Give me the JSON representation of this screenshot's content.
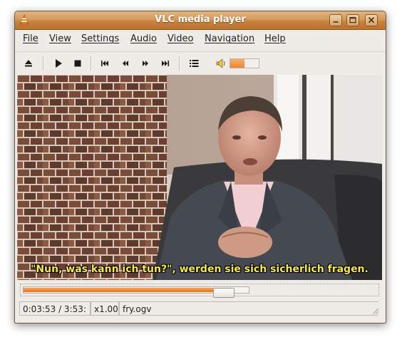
{
  "window": {
    "title": "VLC media player"
  },
  "menu": {
    "items": [
      {
        "label": "File"
      },
      {
        "label": "View"
      },
      {
        "label": "Settings"
      },
      {
        "label": "Audio"
      },
      {
        "label": "Video"
      },
      {
        "label": "Navigation"
      },
      {
        "label": "Help"
      }
    ]
  },
  "toolbar": {
    "buttons": [
      {
        "icon": "eject-icon"
      },
      {
        "icon": "play-icon"
      },
      {
        "icon": "stop-icon"
      },
      {
        "icon": "previous-icon"
      },
      {
        "icon": "rewind-icon"
      },
      {
        "icon": "fast-forward-icon"
      },
      {
        "icon": "next-icon"
      },
      {
        "icon": "playlist-icon"
      }
    ],
    "volume": {
      "icon": "speaker-icon",
      "level": 0.5
    }
  },
  "video": {
    "subtitle": "\"Nun, was kann ich tun?\", werden sie sich sicherlich fragen."
  },
  "seek": {
    "position": 0.93
  },
  "status": {
    "time": "0:03:53 / 3:53:",
    "speed": "x1.00",
    "file": "fry.ogv"
  },
  "colors": {
    "accent": "#e8872f",
    "titlebar": "#c9833e",
    "subtitle": "#f8e94b"
  }
}
